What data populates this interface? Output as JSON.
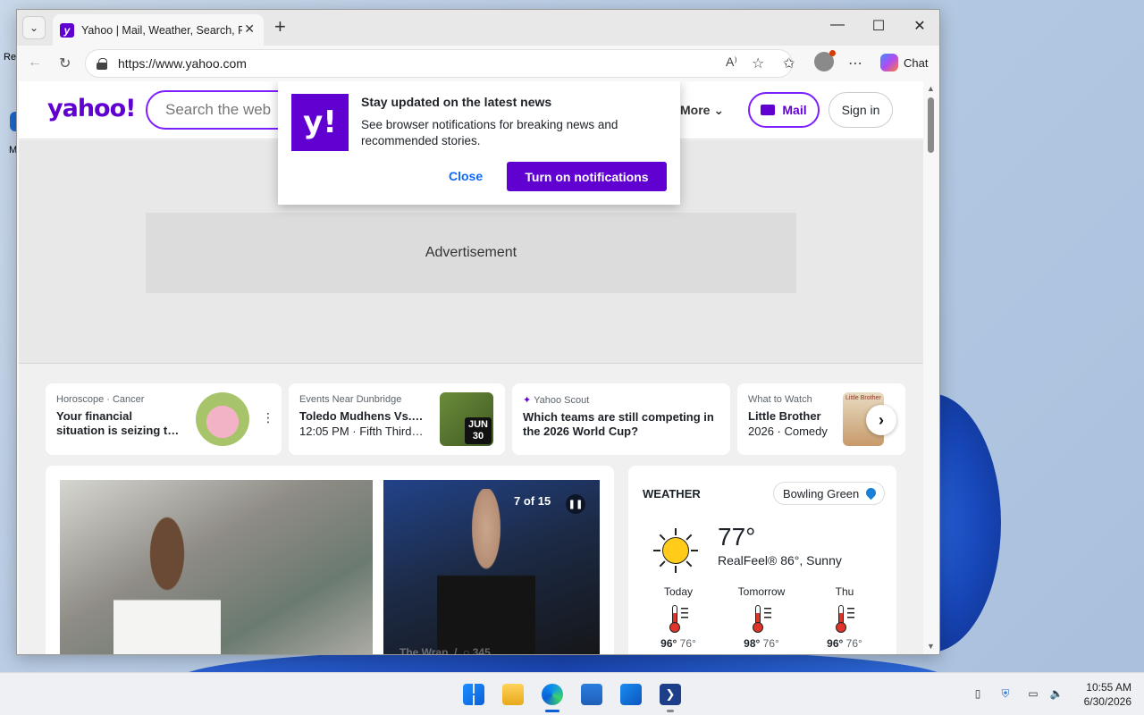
{
  "desktop": {
    "icon1_label": "Re",
    "icon2_label": "M"
  },
  "browser": {
    "tab_title": "Yahoo | Mail, Weather, Search, Poli",
    "url": "https://www.yahoo.com",
    "chat_label": "Chat"
  },
  "yahoo": {
    "logo": "yahoo!",
    "search_placeholder": "Search the web",
    "more_label": "More",
    "mail_label": "Mail",
    "signin_label": "Sign in",
    "ad_label": "Advertisement"
  },
  "notification": {
    "logo": "y!",
    "title": "Stay updated on the latest news",
    "body": "See browser notifications for breaking news and recommended stories.",
    "close_label": "Close",
    "turnon_label": "Turn on notifications"
  },
  "cards": [
    {
      "category": "Horoscope · Cancer",
      "title": "Your financial situation is seizing t…"
    },
    {
      "category": "Events Near Dunbridge",
      "title": "Toledo Mudhens Vs.…",
      "sub": "12:05 PM · Fifth Third…",
      "badge_month": "JUN",
      "badge_day": "30"
    },
    {
      "category": "Yahoo Scout",
      "title": "Which teams are still competing in the 2026 World Cup?"
    },
    {
      "category": "What to Watch",
      "title": "Little Brother",
      "sub": "2026 · Comedy",
      "poster_text": "Little Brother"
    }
  ],
  "news": {
    "counter": "7 of 15",
    "source": "The Wrap",
    "comments": "345"
  },
  "weather": {
    "title": "WEATHER",
    "location": "Bowling Green",
    "temp": "77°",
    "realfeel": "RealFeel® 86°, Sunny",
    "forecast": [
      {
        "day": "Today",
        "high": "96°",
        "low": "76°"
      },
      {
        "day": "Tomorrow",
        "high": "98°",
        "low": "76°"
      },
      {
        "day": "Thu",
        "high": "96°",
        "low": "76°"
      }
    ]
  },
  "taskbar": {
    "time": "10:55 AM",
    "date": "6/30/2026"
  },
  "colors": {
    "yahoo_purple": "#6001d2",
    "link_blue": "#0f69ff",
    "taskbar_accent": "#0a5fd8"
  }
}
